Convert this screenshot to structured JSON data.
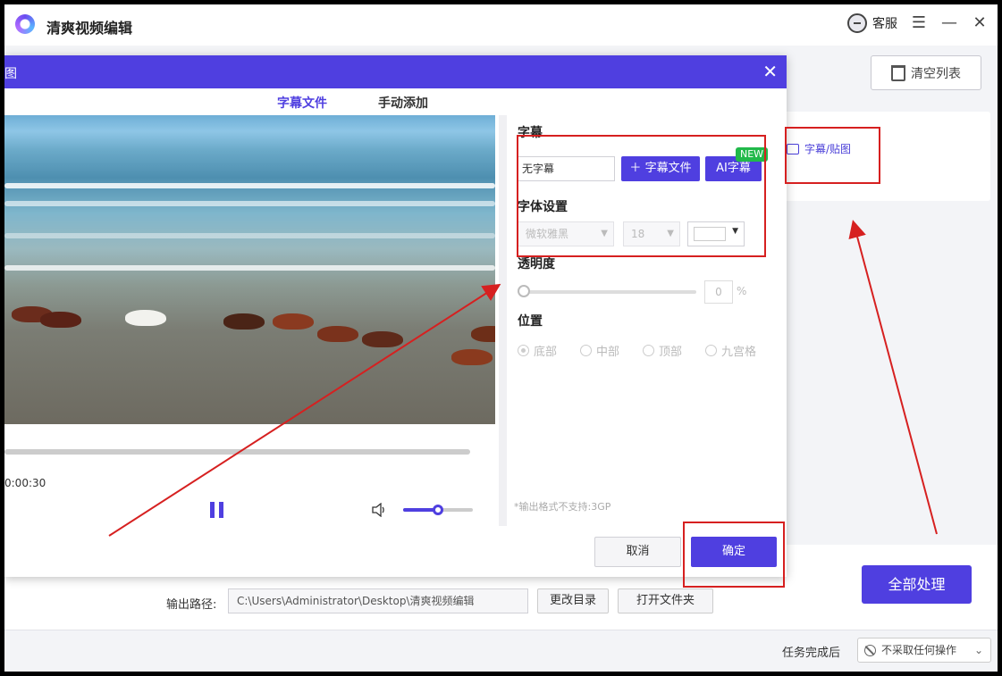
{
  "app": {
    "title": "清爽视频编辑",
    "service_label": "客服",
    "clear_list_label": "清空列表",
    "subtitle_link_label": "字幕/贴图",
    "output_path_label": "输出路径:",
    "output_path_value": "C:\\Users\\Administrator\\Desktop\\清爽视频编辑",
    "change_dir_label": "更改目录",
    "open_folder_label": "打开文件夹",
    "process_all_label": "全部处理",
    "after_task_label": "任务完成后",
    "after_task_value": "不采取任何操作"
  },
  "dialog": {
    "title_fragment": "图",
    "tabs": [
      "字幕文件",
      "手动添加"
    ],
    "active_tab": 0,
    "player": {
      "time": "0:00:30",
      "progress": 0.0,
      "volume": 0.5
    },
    "settings": {
      "subtitle_section": "字幕",
      "subtitle_value": "无字幕",
      "add_subtitle_file_label": "字幕文件",
      "ai_subtitle_label": "AI字幕",
      "new_badge": "NEW",
      "font_section": "字体设置",
      "font_family_value": "微软雅黑",
      "font_size_value": "18",
      "font_color": "#ffffff",
      "opacity_section": "透明度",
      "opacity_value": "0",
      "opacity_unit": "%",
      "position_section": "位置",
      "positions": [
        "底部",
        "中部",
        "顶部",
        "九宫格"
      ],
      "selected_position": 0,
      "note": "*输出格式不支持:3GP"
    },
    "cancel_label": "取消",
    "confirm_label": "确定"
  },
  "colors": {
    "accent": "#4f3fe0",
    "annotation": "#d62020",
    "badge": "#21b94a"
  }
}
